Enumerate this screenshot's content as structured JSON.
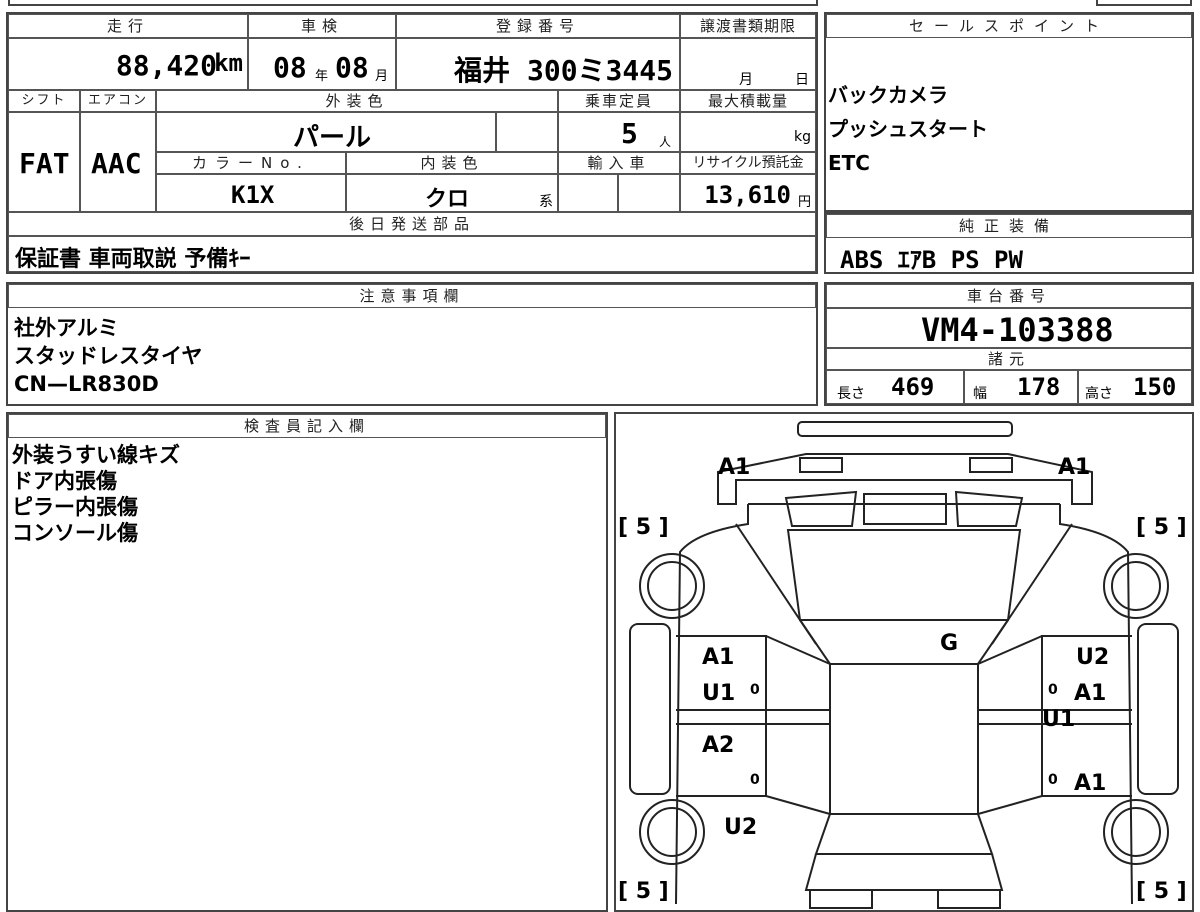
{
  "top": {
    "mileage_h": "走行",
    "mileage": "88,420",
    "mileage_unit": "km",
    "inspection_h": "車検",
    "insp_year": "08",
    "insp_year_unit": "年",
    "insp_month": "08",
    "insp_month_unit": "月",
    "reg_h": "登録番号",
    "reg_number": "福井 300ミ3445",
    "transfer_h": "譲渡書類期限",
    "transfer_month": "月",
    "transfer_day": "日"
  },
  "row2": {
    "shift_h": "シフト",
    "shift": "FAT",
    "ac_h": "エアコン",
    "ac": "AAC",
    "ext_color_h": "外装色",
    "ext_color": "パール",
    "capacity_h": "乗車定員",
    "capacity": "5",
    "capacity_unit": "人",
    "load_h": "最大積載量",
    "load_unit": "kg",
    "color_no_h": "カラーNo.",
    "color_no": "K1X",
    "int_color_h": "内装色",
    "int_color": "クロ",
    "int_color_suffix": "系",
    "import_h": "輸入車",
    "recycle_h": "リサイクル預託金",
    "recycle": "13,610",
    "recycle_unit": "円"
  },
  "later_h": "後日発送部品",
  "later": "保証書 車両取説 予備ｷｰ",
  "sales_h": "セールスポイント",
  "sales": [
    "バックカメラ",
    "プッシュスタート",
    "ETC"
  ],
  "equip_h": "純正装備",
  "equip": "ABS ｴｱB PS PW",
  "notes_h": "注意事項欄",
  "notes": [
    "社外アルミ",
    "スタッドレスタイヤ",
    "CN—LR830D"
  ],
  "chassis_h": "車台番号",
  "chassis": "VM4-103388",
  "spec_h": "諸元",
  "spec": {
    "len_label": "長さ",
    "len": "469",
    "width_label": "幅",
    "width": "178",
    "height_label": "高さ",
    "height": "150"
  },
  "inspector_h": "検査員記入欄",
  "inspector": [
    "外装うすい線キズ",
    "ドア内張傷",
    "ピラー内張傷",
    "コンソール傷"
  ],
  "diagram": {
    "tire_top_left": "[ 5 ]",
    "tire_top_right": "[ 5 ]",
    "tire_bottom_left": "[ 5 ]",
    "tire_bottom_right": "[ 5 ]",
    "front_left": "A1",
    "front_right": "A1",
    "windshield": "G",
    "left_front_door": [
      "A1",
      "U1"
    ],
    "left_rear_door": "A2",
    "left_rear": "U2",
    "right_front_door": [
      "U2",
      "A1"
    ],
    "right_mid": "U1",
    "right_rear_door": "A1",
    "zero": "0"
  }
}
